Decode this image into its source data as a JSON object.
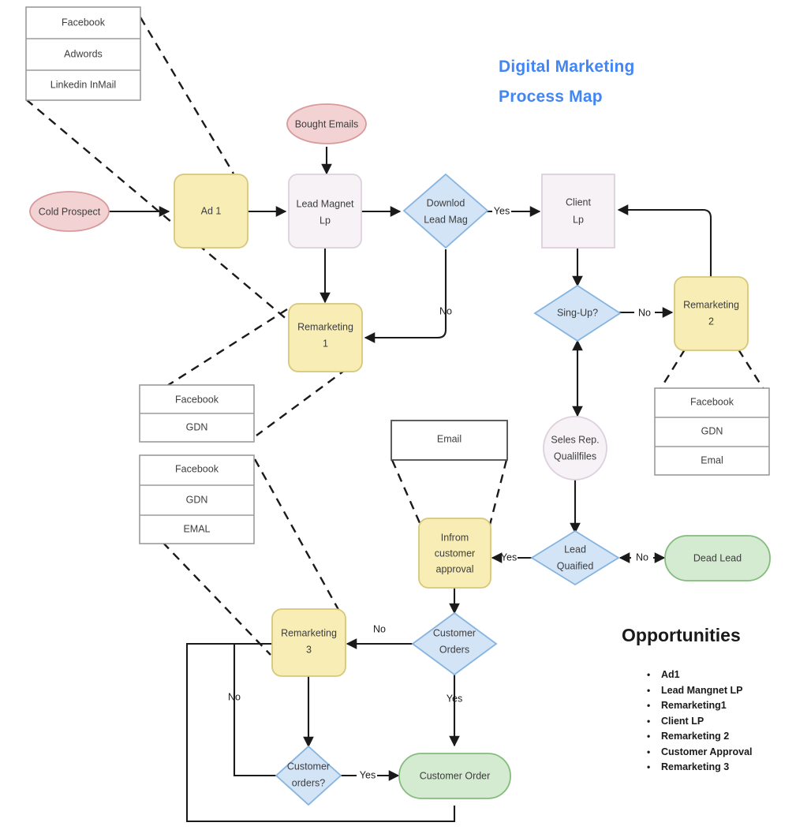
{
  "title": {
    "line1": "Digital Marketing",
    "line2": "Process Map",
    "color": "#4285f4"
  },
  "opportunities": {
    "heading": "Opportunities",
    "items": [
      "Ad1",
      "Lead Mangnet LP",
      "Remarketing1",
      "Client LP",
      "Remarketing 2",
      "Customer Approval",
      "Remarketing 3"
    ]
  },
  "nodes": {
    "cold_prospect": "Cold Prospect",
    "bought_emails": "Bought Emails",
    "ad1": "Ad 1",
    "lead_magnet_l1": "Lead  Magnet",
    "lead_magnet_l2": "Lead  Magnet",
    "lead_magnet_l2b": "Lp",
    "downlod_l1": "Downlod",
    "downlod_l2": "Lead Mag",
    "client_l1": "Client",
    "client_l2": "Lp",
    "singup": "Sing-Up?",
    "remarketing2_l1": "Remarketing",
    "remarketing2_l2": "2",
    "remarketing1_l1": "Remarketing",
    "remarketing1_l2": "1",
    "seles_l1": "Seles Rep.",
    "seles_l2": "Qualilfiles",
    "email": "Email",
    "infrom_l1": "Infrom",
    "infrom_l2": "customer",
    "infrom_l3": "approval",
    "lead_qualified_l1": "Lead",
    "lead_qualified_l2": "Quaified",
    "dead_lead": "Dead Lead",
    "customer_orders_l1": "Customer",
    "customer_orders_l2": "Orders",
    "remarketing3_l1": "Remarketing",
    "remarketing3_l2": "3",
    "customer_orders_q_l1": "Customer",
    "customer_orders_q_l2": "orders?",
    "customer_order": "Customer Order"
  },
  "lists": {
    "channels_top": [
      "Facebook",
      "Adwords",
      "Linkedin InMail"
    ],
    "channels_remarketing1": [
      "Facebook",
      "GDN"
    ],
    "channels_remarketing3": [
      "Facebook",
      "GDN",
      "EMAL"
    ],
    "channels_remarketing2": [
      "Facebook",
      "GDN",
      "Emal"
    ]
  },
  "edges": {
    "yes_download": "Yes",
    "no_download": "No",
    "no_singup": "No",
    "yes_lead_qualified": "Yes",
    "no_lead_qualified": "No",
    "no_customer_orders": "No",
    "yes_customer_orders": "Yes",
    "no_loop_left": "No",
    "yes_customer_orders_q": "Yes"
  },
  "colors": {
    "yellow_fill": "#f7edb5",
    "yellow_stroke": "#d6c77a",
    "blue_fill": "#d3e4f7",
    "blue_stroke": "#86b4e0",
    "pink_fill": "#f3d2d3",
    "pink_stroke": "#d99a9c",
    "green_fill": "#d4ead1",
    "green_stroke": "#85bb7e",
    "lavender_fill": "#f6f2f6",
    "lavender_stroke": "#dcd0dc",
    "line": "#1a1a1a"
  }
}
